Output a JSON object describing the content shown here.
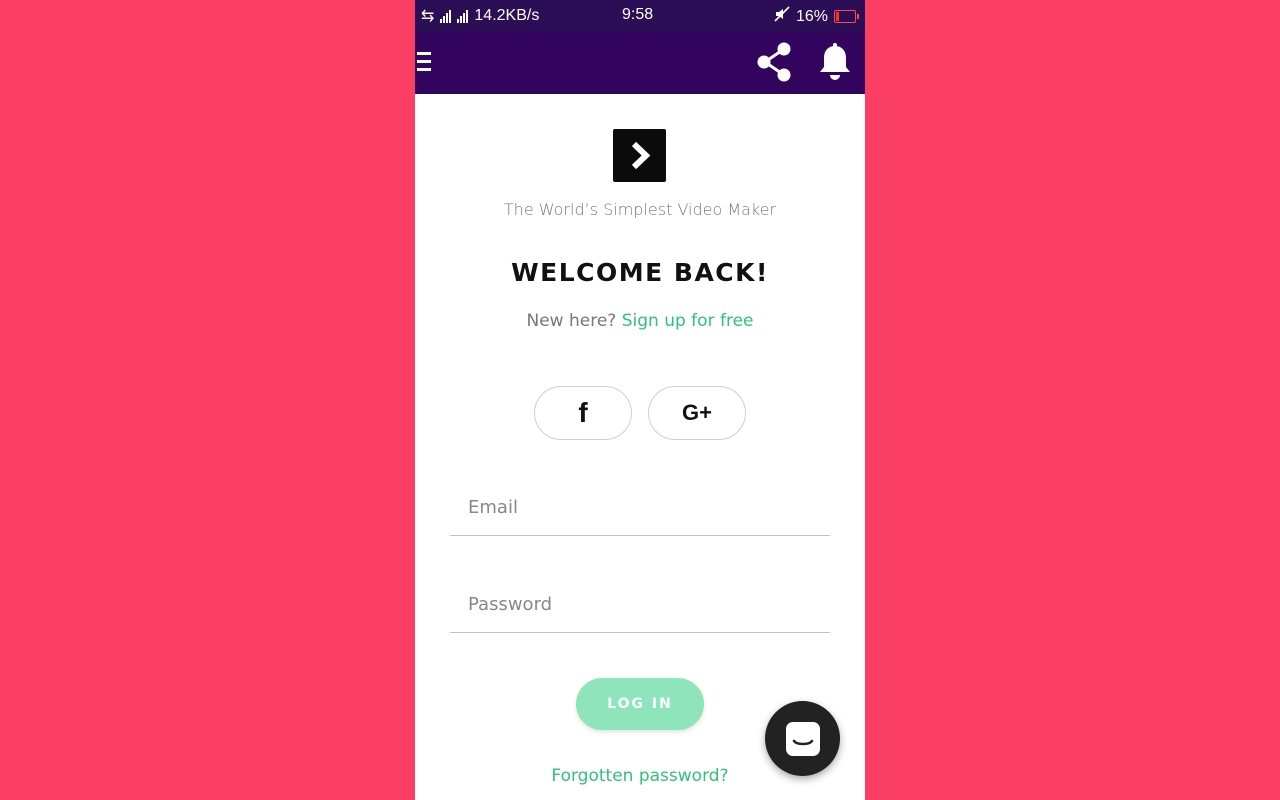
{
  "status_bar": {
    "network_speed": "14.2KB/s",
    "time": "9:58",
    "battery": "16%",
    "battery_color": "#ff2b2b"
  },
  "app_bar": {
    "background": "#33045d",
    "icons": [
      "menu-icon",
      "share-icon",
      "bell-icon"
    ]
  },
  "header": {
    "logo_icon": "play-chevron-icon",
    "tagline": "The World’s Simplest Video Maker"
  },
  "login": {
    "title": "WELCOME BACK!",
    "new_here": "New here?",
    "signup_link": "Sign up for free",
    "social": {
      "facebook_glyph": "f",
      "google_glyph": "G+"
    },
    "email_placeholder": "Email",
    "password_placeholder": "Password",
    "login_button": "LOG IN",
    "forgot_link": "Forgotten password?"
  },
  "colors": {
    "page_background": "#fb3f64",
    "accent_green": "#2ec279",
    "login_button": "#8ee5bb"
  },
  "chat_widget": {
    "icon": "chat-icon"
  }
}
